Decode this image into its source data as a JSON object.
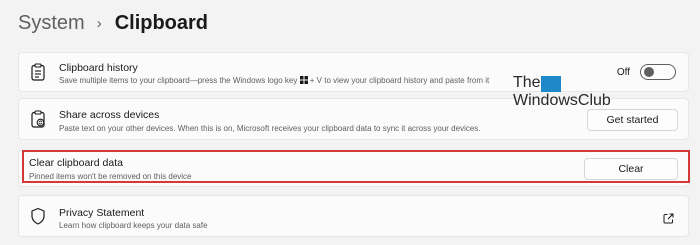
{
  "breadcrumb": {
    "parent": "System",
    "separator": "›",
    "current": "Clipboard"
  },
  "clipboard_history": {
    "title": "Clipboard history",
    "desc_before_key": "Save multiple items to your clipboard—press the Windows logo key ",
    "key_icon": "windows-logo-key-icon",
    "desc_after_key": " + V to view your clipboard history and paste from it",
    "toggle_label": "Off",
    "toggle_state": "off",
    "icon": "clipboard-icon"
  },
  "share_devices": {
    "title": "Share across devices",
    "desc": "Paste text on your other devices. When this is on, Microsoft receives your clipboard data to sync it across your devices.",
    "button": "Get started",
    "icon": "clipboard-sync-icon"
  },
  "clear_data": {
    "title": "Clear clipboard data",
    "desc": "Pinned items won't be removed on this device",
    "button": "Clear",
    "highlight_color": "#d23a3a"
  },
  "privacy": {
    "title": "Privacy Statement",
    "desc": "Learn how clipboard keeps your data safe",
    "icon": "shield-icon",
    "link_icon": "external-link-icon"
  },
  "watermark": {
    "line1": "The",
    "line2": "WindowsClub",
    "accent": "#1e88c8"
  }
}
